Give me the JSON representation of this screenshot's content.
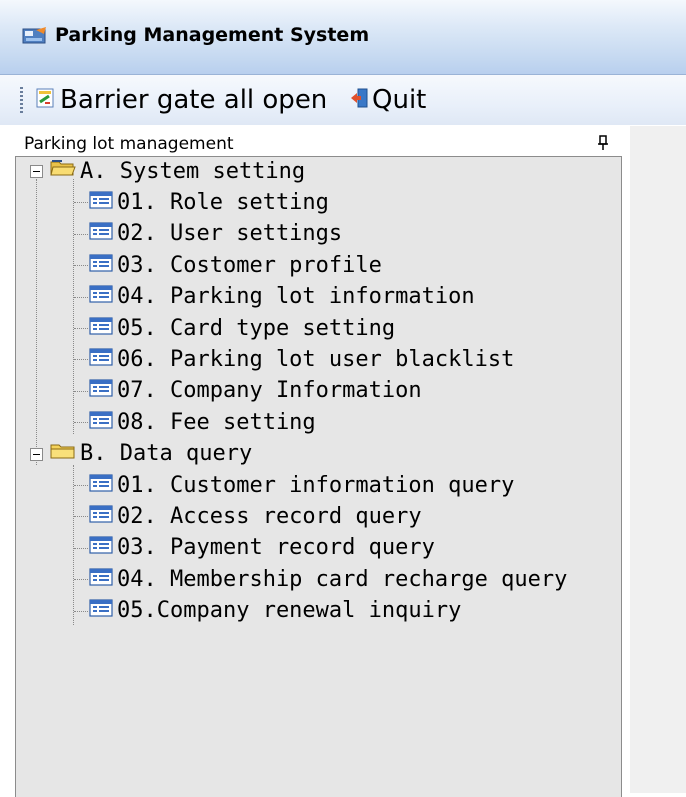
{
  "window": {
    "title": "Parking Management System"
  },
  "toolbar": {
    "gate_open_label": "Barrier gate all open",
    "quit_label": "Quit"
  },
  "panel": {
    "title": "Parking lot management",
    "pin_symbol": "1"
  },
  "tree": {
    "groups": [
      {
        "label": "A. System setting",
        "items": [
          "01. Role setting",
          "02. User settings",
          "03. Costomer profile",
          "04. Parking lot information",
          "05. Card type setting",
          "06. Parking lot user blacklist",
          "07. Company Information",
          "08. Fee setting"
        ]
      },
      {
        "label": "B. Data query",
        "items": [
          "01. Customer information query",
          "02. Access record query",
          "03. Payment record query",
          "04. Membership card recharge query",
          "05.Company renewal inquiry"
        ]
      }
    ]
  },
  "icons": {
    "app": "parking-app-icon",
    "gate": "barrier-gate-icon",
    "quit": "exit-door-icon",
    "pin": "pin-icon",
    "folder": "folder-icon",
    "item": "form-icon"
  },
  "colors": {
    "title_gradient_top": "#f4f8fd",
    "title_gradient_bottom": "#b8cfee",
    "tree_background": "#e6e6e6",
    "folder_yellow": "#f5d35a",
    "item_icon_blue": "#3a6fc4"
  }
}
